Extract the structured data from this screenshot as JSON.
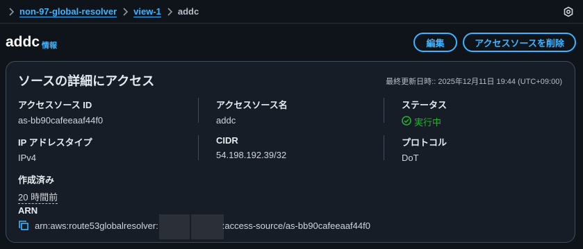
{
  "breadcrumb": {
    "items": [
      "non-97-global-resolver",
      "view-1"
    ],
    "current": "addc"
  },
  "header": {
    "title": "addc",
    "info_label": "情報",
    "edit_label": "編集",
    "delete_label": "アクセスソースを削除"
  },
  "panel": {
    "title": "ソースの詳細にアクセス",
    "last_updated": "最終更新日時:: 2025年12月11日 19:44 (UTC+09:00)",
    "fields": {
      "access_source_id_label": "アクセスソース ID",
      "access_source_id_value": "as-bb90cafeeaaf44f0",
      "access_source_name_label": "アクセスソース名",
      "access_source_name_value": "addc",
      "status_label": "ステータス",
      "status_value": "実行中",
      "ip_type_label": "IP アドレスタイプ",
      "ip_type_value": "IPv4",
      "cidr_label": "CIDR",
      "cidr_value": "54.198.192.39/32",
      "protocol_label": "プロトコル",
      "protocol_value": "DoT",
      "created_label": "作成済み",
      "created_value": "20 時間前",
      "arn_label": "ARN",
      "arn_prefix": "arn:aws:route53globalresolver:",
      "arn_suffix": ":access-source/as-bb90cafeeaaf44f0"
    }
  },
  "colors": {
    "background": "#0f141a",
    "panel": "#161d26",
    "link": "#42b4ff",
    "success": "#29ad32"
  }
}
